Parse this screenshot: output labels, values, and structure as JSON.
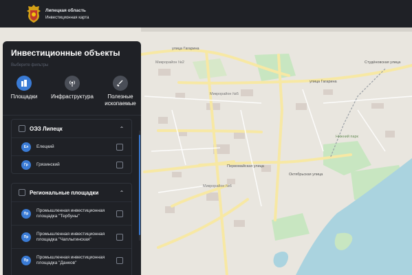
{
  "header": {
    "region": "Липецкая область",
    "subtitle": "Инвестиционная карта"
  },
  "panel": {
    "title": "Инвестиционные объекты",
    "hint": "Выберите фильтры",
    "filters": [
      {
        "label": "Площадки",
        "active": true,
        "icon": "buildings-icon"
      },
      {
        "label": "Инфраструктура",
        "active": false,
        "icon": "broadcast-icon"
      },
      {
        "label": "Полезные ископаемые",
        "active": false,
        "icon": "shovel-icon"
      }
    ],
    "groups": [
      {
        "name": "ОЭЗ Липецк",
        "items": [
          {
            "badge": "Ел",
            "name": "Елецкий"
          },
          {
            "badge": "Гр",
            "name": "Грязинский"
          }
        ]
      },
      {
        "name": "Региональные площадки",
        "items": [
          {
            "badge": "Пр",
            "name": "Промышленная инвестиционная площадка \"Тербуны\""
          },
          {
            "badge": "Пр",
            "name": "Промышленная инвестиционная площадка \"Чаплыгинская\""
          },
          {
            "badge": "Пр",
            "name": "Промышленная инвестиционная площадка \"Данков\""
          }
        ]
      }
    ]
  },
  "map": {
    "labels": [
      "улица Гагарина",
      "Микрорайон №2",
      "Микрорайон №5",
      "Микрорайон №6",
      "Первомайская улица",
      "Октябрьская улица",
      "Нижний парк",
      "Студёновская улица",
      "улица Гагарина"
    ],
    "colors": {
      "water": "#aad3df",
      "park": "#c8e6c1",
      "road": "#f7e8a4",
      "land": "#e9e6df"
    }
  }
}
